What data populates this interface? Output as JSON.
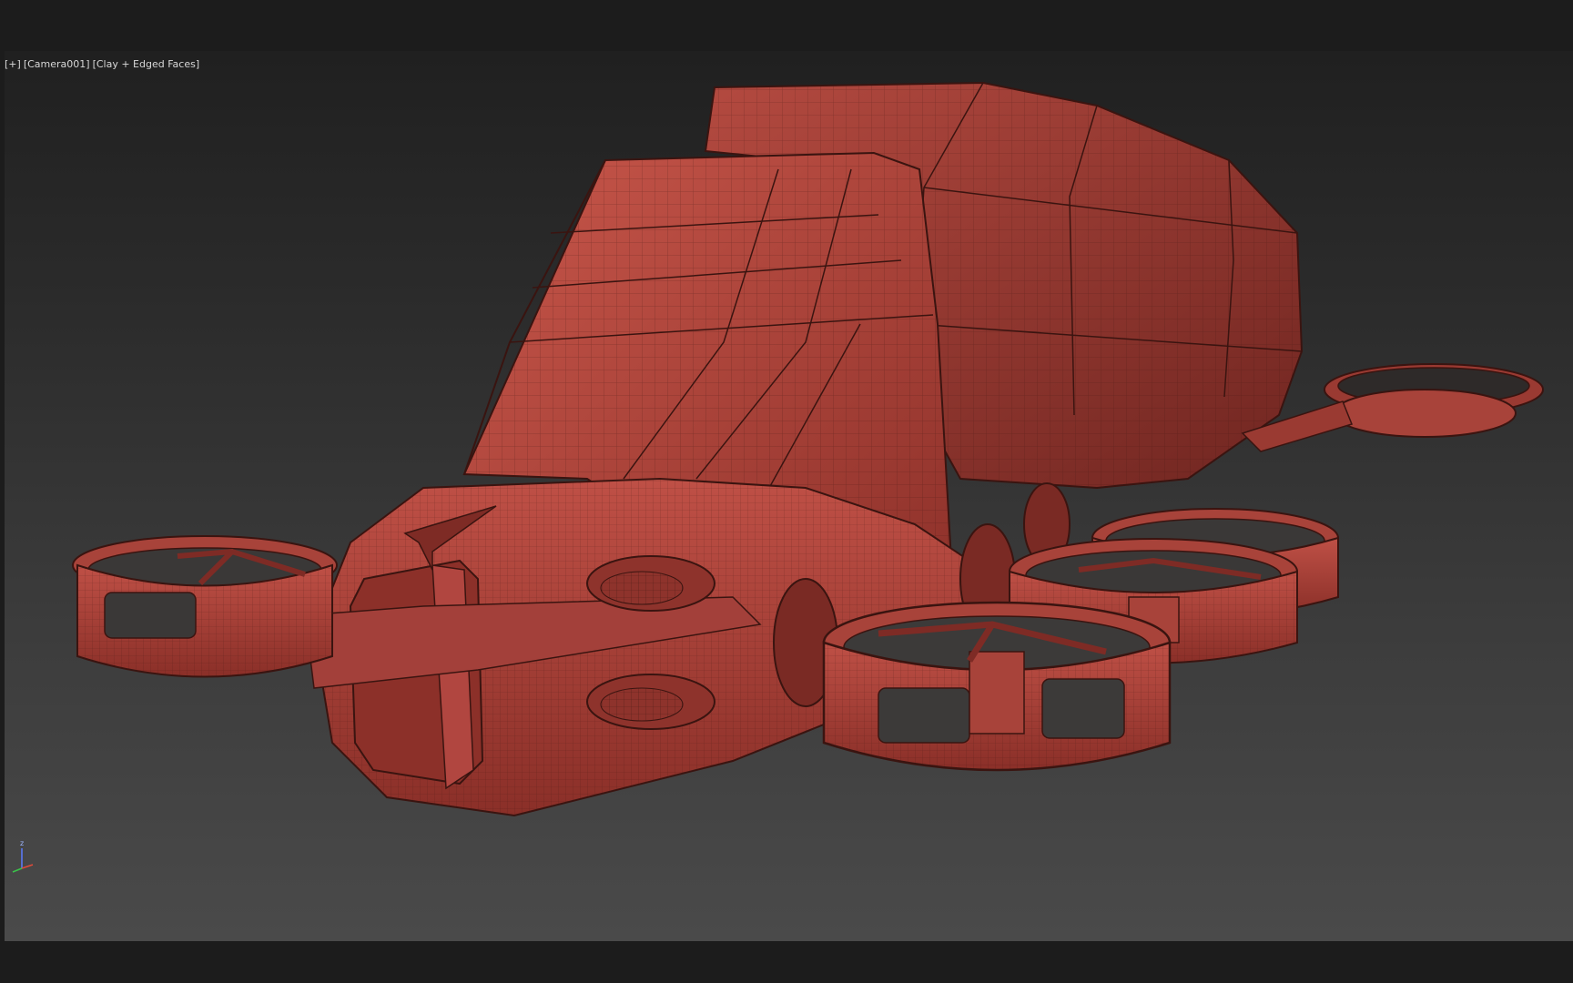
{
  "viewport": {
    "label_plus": "[+]",
    "label_camera": "[Camera001]",
    "label_shading": "[Clay + Edged Faces]",
    "axis_z": "z"
  },
  "colors": {
    "clay": "#b5473d",
    "clay_dark": "#7e2b25",
    "clay_light": "#c9574b",
    "wire": "#3a1410",
    "bg_top": "#202020",
    "bg_bottom": "#4a4a4a"
  },
  "icons": {
    "axis_gizmo": "xyz-axis-icon"
  }
}
